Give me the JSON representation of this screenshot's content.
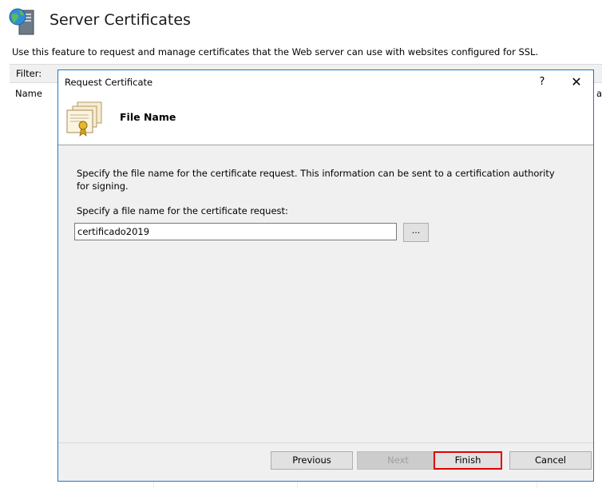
{
  "page": {
    "title": "Server Certificates",
    "description": "Use this feature to request and manage certificates that the Web server can use with websites configured for SSL.",
    "filter_label": "Filter:",
    "column_name": "Name",
    "column_cut": "as"
  },
  "dialog": {
    "title": "Request Certificate",
    "help_glyph": "?",
    "close_glyph": "✕",
    "header_title": "File Name",
    "description": "Specify the file name for the certificate request. This information can be sent to a certification authority for signing.",
    "prompt": "Specify a file name for the certificate request:",
    "file_name_value": "certificado2019",
    "browse_label": "...",
    "buttons": {
      "previous": "Previous",
      "next": "Next",
      "finish": "Finish",
      "cancel": "Cancel"
    },
    "icons": {
      "header": "certificate-icon",
      "page": "server-globe-icon"
    },
    "colors": {
      "accent_border": "#1979ca",
      "highlight": "#e00000"
    }
  }
}
